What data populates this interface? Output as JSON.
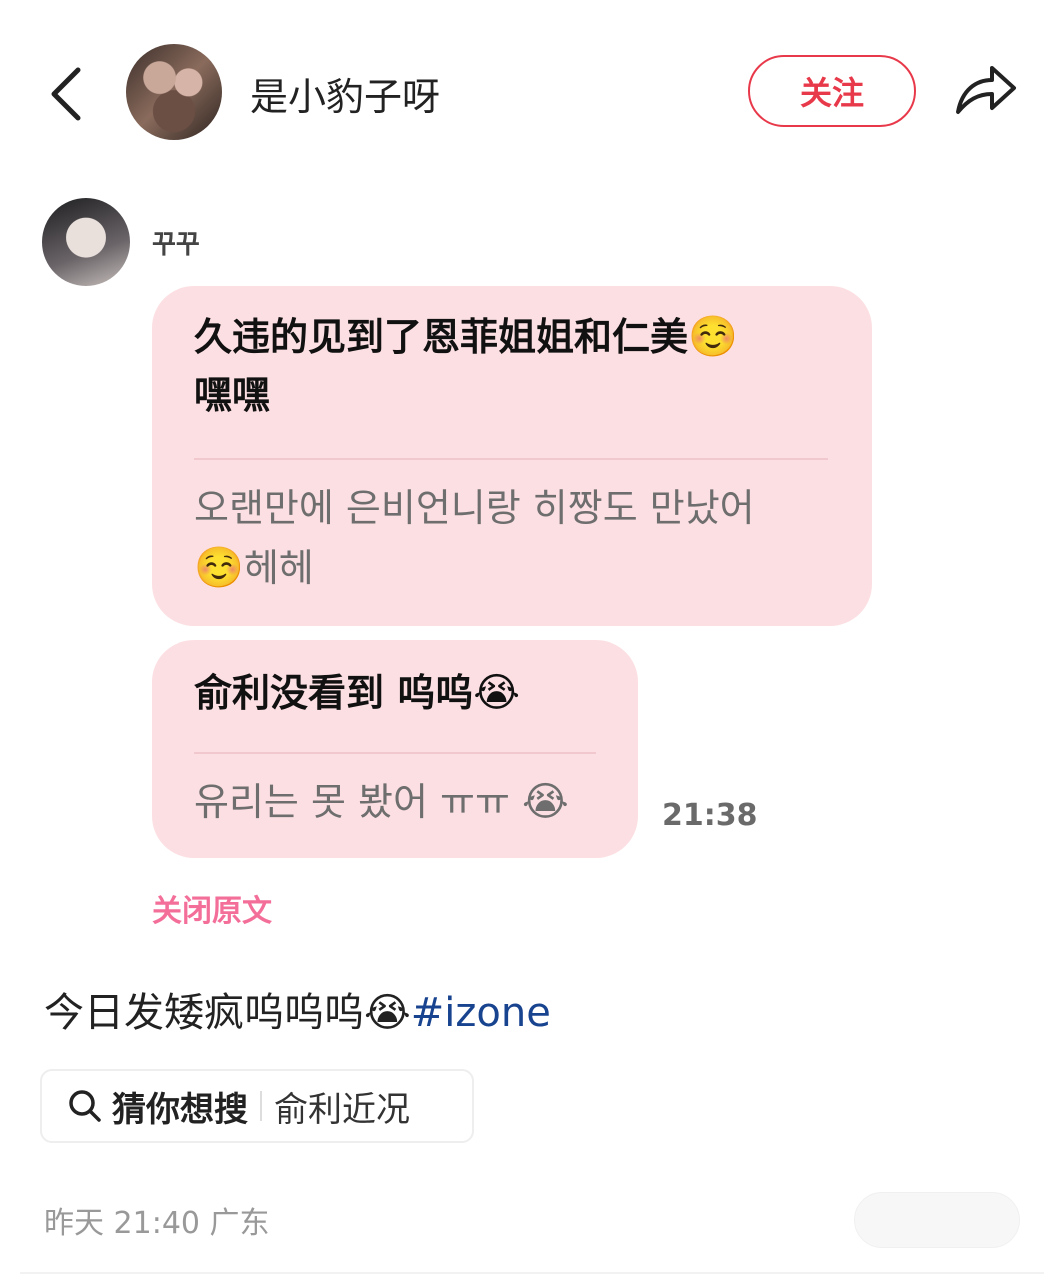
{
  "header": {
    "username": "是小豹子呀",
    "follow_label": "关注"
  },
  "chat": {
    "sender_name": "꾸꾸",
    "messages": [
      {
        "chinese_line1": "久违的见到了恩菲姐姐和仁美",
        "chinese_emoji": "☺️",
        "chinese_line2": "嘿嘿",
        "korean_line1": "오랜만에 은비언니랑 히짱도 만났어",
        "korean_emoji": "☺️",
        "korean_line2": "헤헤"
      },
      {
        "chinese_line1": "俞利没看到 呜呜",
        "chinese_emoji": "😭",
        "korean_line1": "유리는 못 봤어 ㅠㅠ",
        "korean_emoji": "😭"
      }
    ],
    "time": "21:38",
    "close_original": "关闭原文"
  },
  "post": {
    "caption_text": "今日发矮疯呜呜呜",
    "caption_emoji": "😭",
    "hashtag": "#izone"
  },
  "search": {
    "label": "猜你想搜",
    "query": "俞利近况"
  },
  "meta": {
    "timestamp_location": "昨天 21:40 广东"
  },
  "colors": {
    "accent": "#e8394a",
    "bubble": "#fcdfe3",
    "hashtag": "#18438f",
    "close_link": "#f36f9a"
  },
  "icons": [
    "back-arrow-icon",
    "share-icon",
    "search-icon"
  ]
}
